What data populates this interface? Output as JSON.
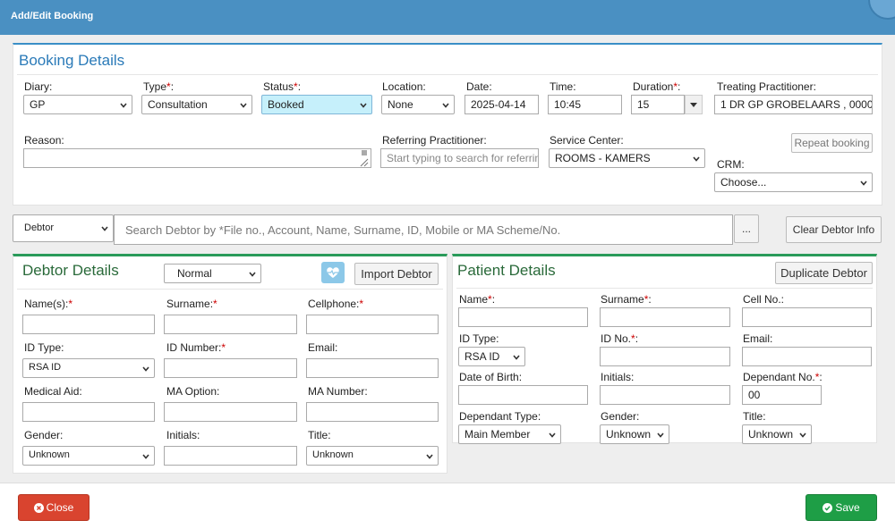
{
  "window": {
    "title": "Add/Edit Booking"
  },
  "booking": {
    "title": "Booking Details",
    "diary": {
      "label": "Diary:",
      "value": "GP"
    },
    "type": {
      "label": "Type",
      "value": "Consultation"
    },
    "status": {
      "label": "Status",
      "value": "Booked"
    },
    "location": {
      "label": "Location:",
      "value": "None"
    },
    "date": {
      "label": "Date:",
      "value": "2025-04-14"
    },
    "time": {
      "label": "Time:",
      "value": "10:45"
    },
    "duration": {
      "label": "Duration",
      "value": "15"
    },
    "practitioner": {
      "label": "Treating Practitioner:",
      "value": "1 DR GP GROBELAARS , 0000"
    },
    "reason": {
      "label": "Reason:",
      "value": ""
    },
    "referring": {
      "label": "Referring Practitioner:",
      "placeholder": "Start typing to search for referrin"
    },
    "service_center": {
      "label": "Service Center:",
      "value": "ROOMS - KAMERS"
    },
    "repeat_label": "Repeat booking",
    "crm": {
      "label": "CRM:",
      "value": "Choose..."
    },
    "required_mark": "*",
    "colon": ":"
  },
  "debtor_search": {
    "type_value": "Debtor",
    "placeholder": "Search Debtor by *File no., Account, Name, Surname, ID, Mobile or MA Scheme/No.",
    "more_label": "...",
    "clear_label": "Clear Debtor Info"
  },
  "debtor": {
    "title": "Debtor Details",
    "category_value": "Normal",
    "import_label": "Import Debtor",
    "names_label": "Name(s):",
    "surname_label": "Surname:",
    "cellphone_label": "Cellphone:",
    "idtype_label": "ID Type:",
    "idtype_value": "RSA ID",
    "idnumber_label": "ID Number:",
    "email_label": "Email:",
    "medaid_label": "Medical Aid:",
    "maoption_label": "MA Option:",
    "manumber_label": "MA Number:",
    "gender_label": "Gender:",
    "gender_value": "Unknown",
    "initials_label": "Initials:",
    "title_label": "Title:",
    "title_value": "Unknown"
  },
  "patient": {
    "title": "Patient Details",
    "duplicate_label": "Duplicate Debtor",
    "name_label": "Name",
    "surname_label": "Surname",
    "cell_label": "Cell No.:",
    "idtype_label": "ID Type:",
    "idtype_value": "RSA ID",
    "idno_label": "ID No.",
    "email_label": "Email:",
    "dob_label": "Date of Birth:",
    "initials_label": "Initials:",
    "depno_label": "Dependant No.",
    "depno_value": "00",
    "deptype_label": "Dependant Type:",
    "deptype_value": "Main Member",
    "gender_label": "Gender:",
    "gender_value": "Unknown",
    "title_label": "Title:",
    "title_value": "Unknown"
  },
  "footer": {
    "close_label": "Close",
    "save_label": "Save"
  },
  "colors": {
    "titlebar": "#4a90c2",
    "status_highlight": "#c6f0fb",
    "close": "#d9442f",
    "save": "#1e9e46",
    "section_green": "#2a9a5a"
  }
}
